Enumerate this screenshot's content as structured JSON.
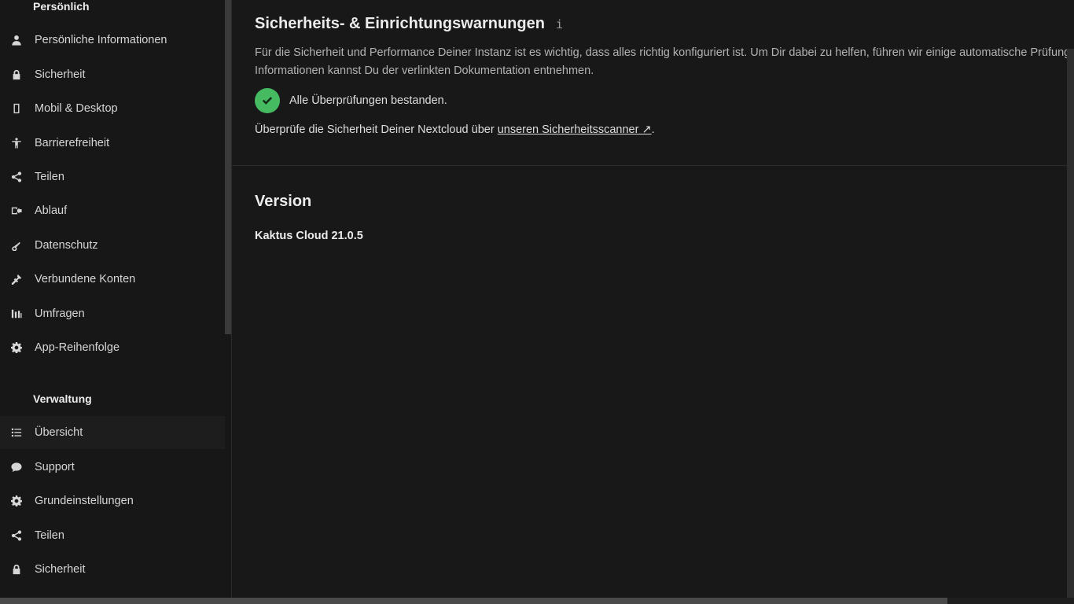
{
  "sidebar": {
    "personal_heading": "Persönlich",
    "personal_items": [
      {
        "label": "Persönliche Informationen",
        "icon": "user-icon"
      },
      {
        "label": "Sicherheit",
        "icon": "lock-icon"
      },
      {
        "label": "Mobil & Desktop",
        "icon": "phone-icon"
      },
      {
        "label": "Barrierefreiheit",
        "icon": "accessibility-icon"
      },
      {
        "label": "Teilen",
        "icon": "share-icon"
      },
      {
        "label": "Ablauf",
        "icon": "workflow-icon"
      },
      {
        "label": "Datenschutz",
        "icon": "key-icon"
      },
      {
        "label": "Verbundene Konten",
        "icon": "connected-accounts-icon"
      },
      {
        "label": "Umfragen",
        "icon": "bar-chart-icon"
      },
      {
        "label": "App-Reihenfolge",
        "icon": "gear-icon"
      }
    ],
    "admin_heading": "Verwaltung",
    "admin_items": [
      {
        "label": "Übersicht",
        "icon": "list-icon",
        "active": true
      },
      {
        "label": "Support",
        "icon": "speech-bubble-icon"
      },
      {
        "label": "Grundeinstellungen",
        "icon": "gear-icon"
      },
      {
        "label": "Teilen",
        "icon": "share-icon"
      },
      {
        "label": "Sicherheit",
        "icon": "lock-icon"
      }
    ]
  },
  "security": {
    "title": "Sicherheits- & Einrichtungswarnungen",
    "info_icon": "i",
    "description_line1": "Für die Sicherheit und Performance Deiner Instanz ist es wichtig, dass alles richtig konfiguriert ist. Um Dir dabei zu helfen, führen wir einige automatische Prüfungen",
    "description_line2": "Informationen kannst Du der verlinkten Dokumentation entnehmen.",
    "status": "Alle Überprüfungen bestanden.",
    "status_color": "#46ba61",
    "scan_prefix": "Überprüfe die Sicherheit Deiner Nextcloud über ",
    "scan_link": "unseren Sicherheitsscanner ↗",
    "scan_suffix": "."
  },
  "version": {
    "title": "Version",
    "value": "Kaktus Cloud 21.0.5"
  }
}
